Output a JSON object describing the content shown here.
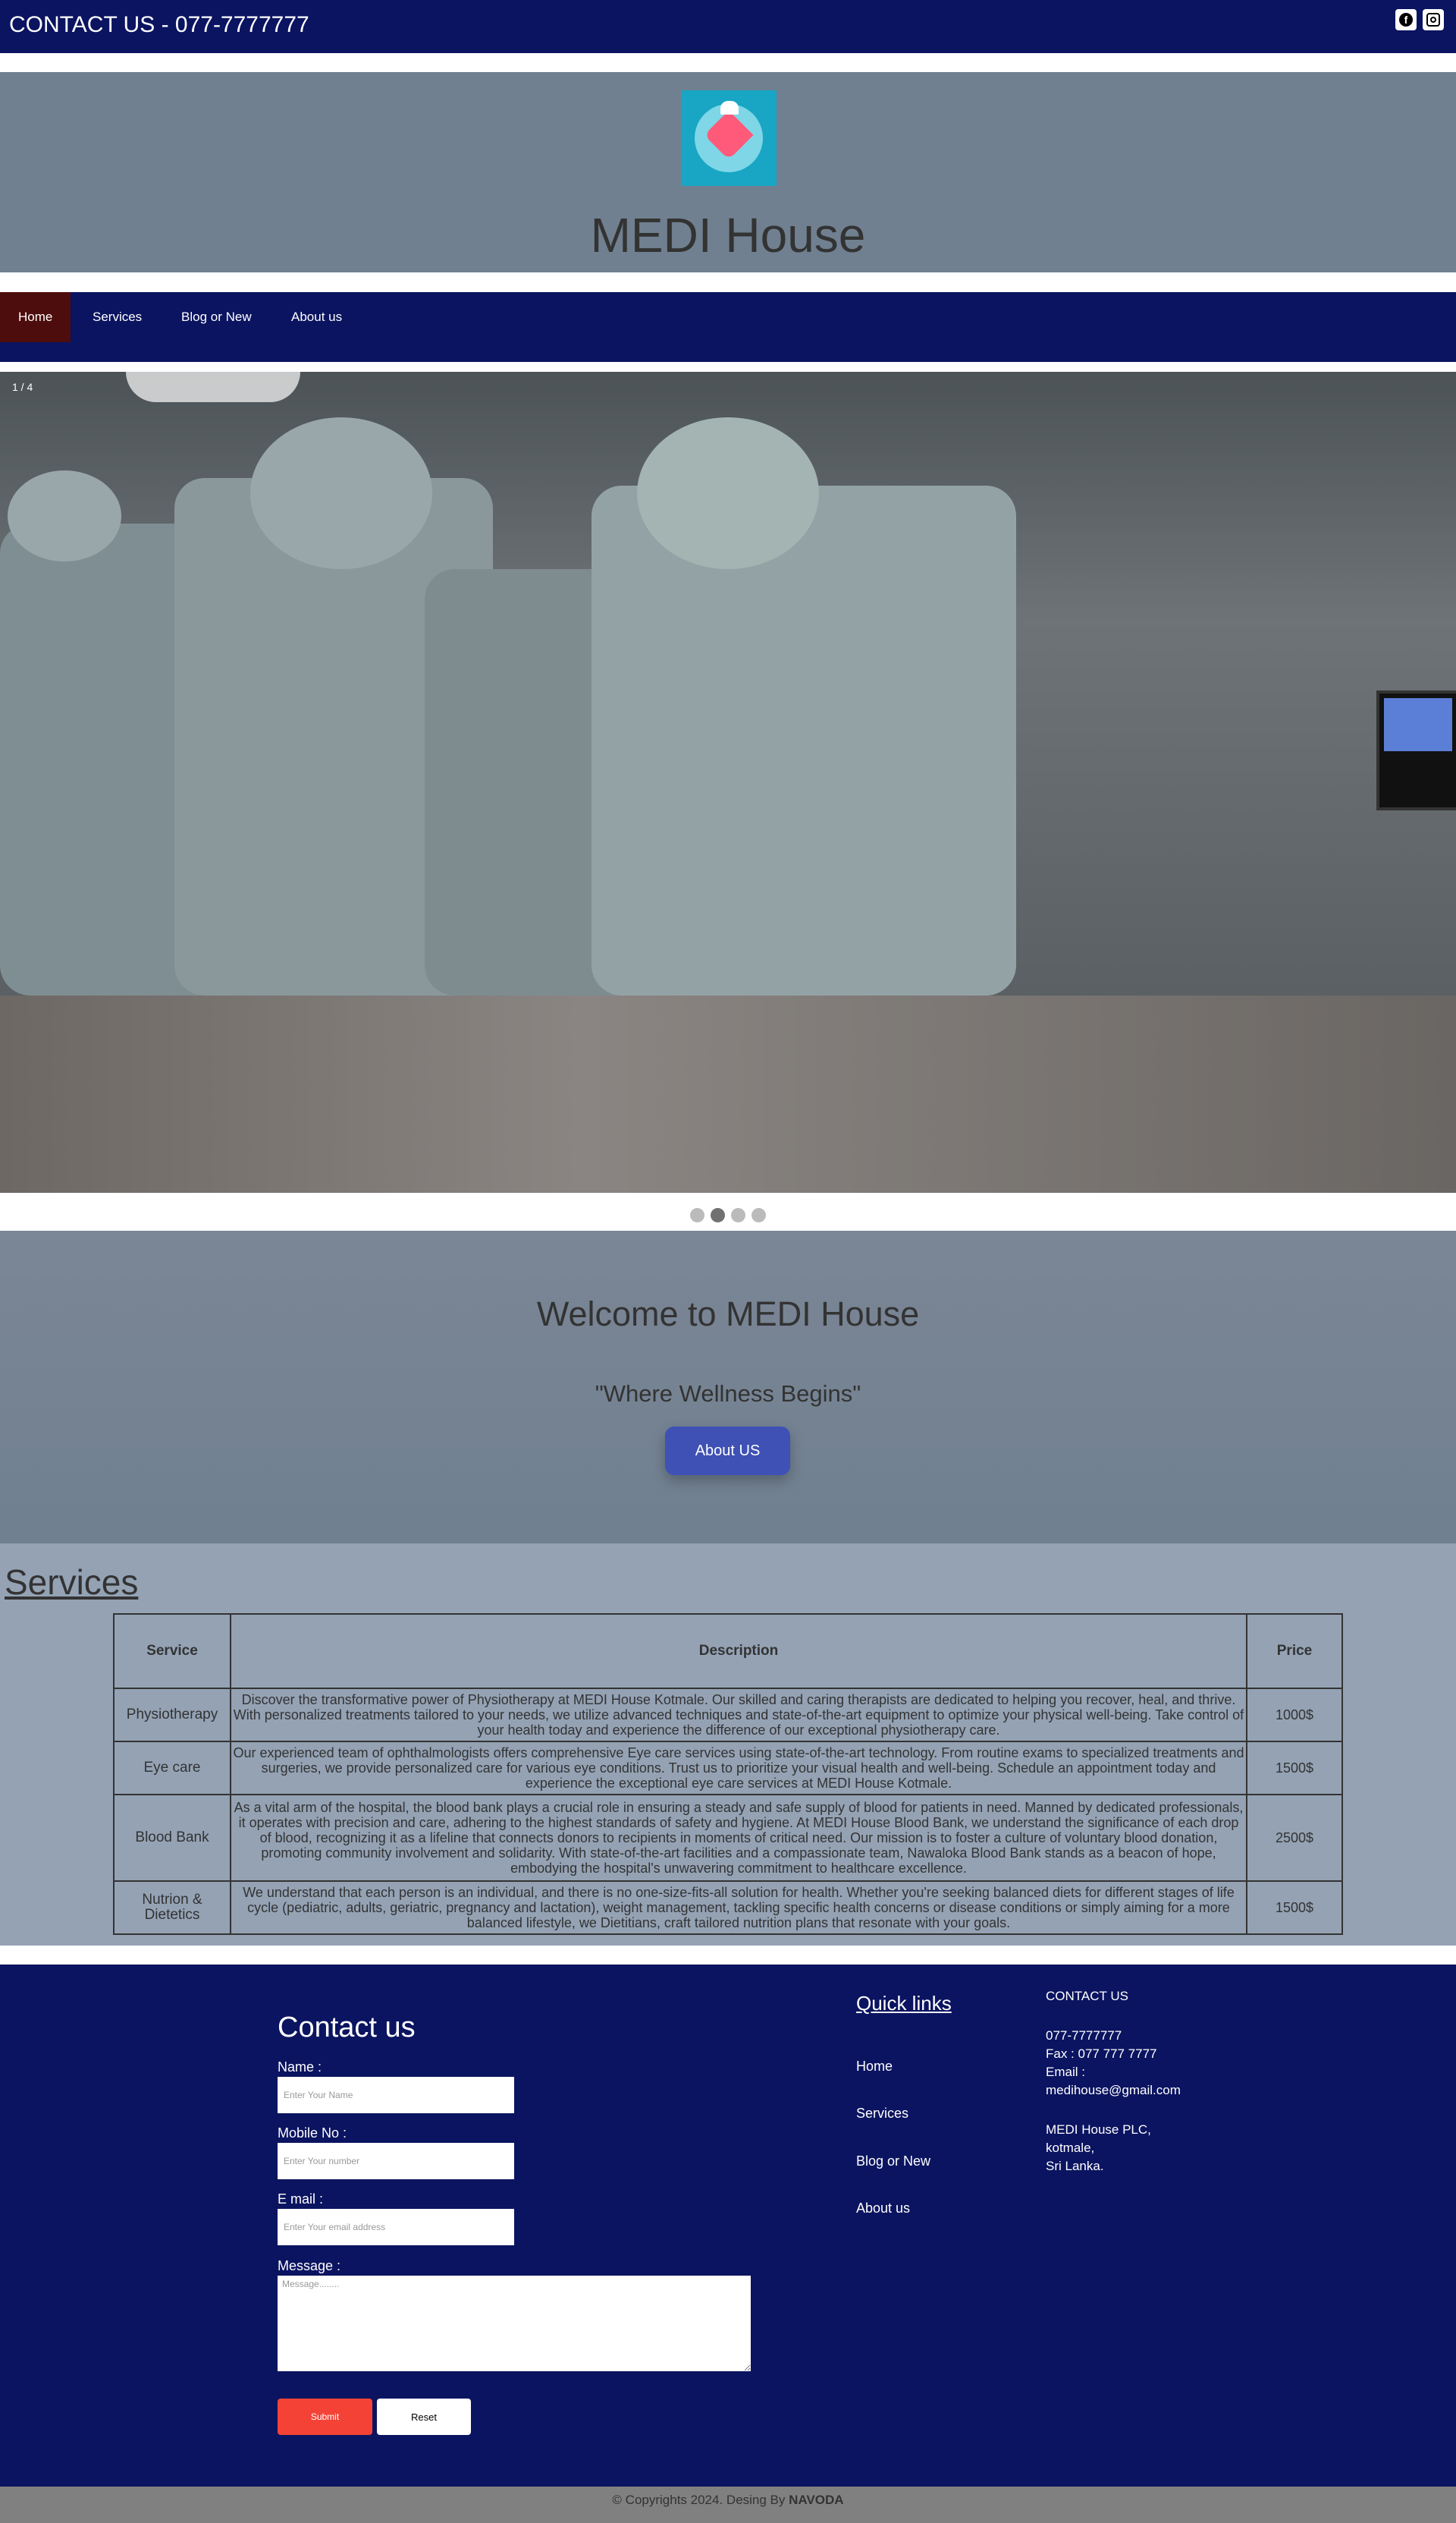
{
  "topbar": {
    "contact": "CONTACT US - 077-7777777",
    "social": [
      "facebook-icon",
      "instagram-icon"
    ]
  },
  "header": {
    "title": "MEDI House"
  },
  "nav": {
    "items": [
      "Home",
      "Services",
      "Blog or New",
      "About us"
    ],
    "active": "Home"
  },
  "slideshow": {
    "counter": "1 / 4",
    "slide_count": 4,
    "active_dot": 2
  },
  "welcome": {
    "heading": "Welcome to MEDI House",
    "tagline": "\"Where Wellness Begins\"",
    "button": "About US"
  },
  "services": {
    "title": "Services",
    "columns": [
      "Service",
      "Description",
      "Price"
    ],
    "rows": [
      {
        "service": "Physiotherapy",
        "description": "Discover the transformative power of Physiotherapy at MEDI House Kotmale. Our skilled and caring therapists are dedicated to helping you recover, heal, and thrive. With personalized treatments tailored to your needs, we utilize advanced techniques and state-of-the-art equipment to optimize your physical well-being. Take control of your health today and experience the difference of our exceptional physiotherapy care.",
        "price": "1000$"
      },
      {
        "service": "Eye care",
        "description": "Our experienced team of ophthalmologists offers comprehensive Eye care services using state-of-the-art technology. From routine exams to specialized treatments and surgeries, we provide personalized care for various eye conditions. Trust us to prioritize your visual health and well-being. Schedule an appointment today and experience the exceptional eye care services at MEDI House Kotmale.",
        "price": "1500$"
      },
      {
        "service": "Blood Bank",
        "description": "As a vital arm of the hospital, the blood bank plays a crucial role in ensuring a steady and safe supply of blood for patients in need. Manned by dedicated professionals, it operates with precision and care, adhering to the highest standards of safety and hygiene. At MEDI House Blood Bank, we understand the significance of each drop of blood, recognizing it as a lifeline that connects donors to recipients in moments of critical need. Our mission is to foster a culture of voluntary blood donation, promoting community involvement and solidarity. With state-of-the-art facilities and a compassionate team, Nawaloka Blood Bank stands as a beacon of hope, embodying the hospital's unwavering commitment to healthcare excellence.",
        "price": "2500$"
      },
      {
        "service": "Nutrion & Dietetics",
        "description": "We understand that each person is an individual, and there is no one-size-fits-all solution for health. Whether you're seeking balanced diets for different stages of life cycle (pediatric, adults, geriatric, pregnancy and lactation), weight management, tackling specific health concerns or disease conditions or simply aiming for a more balanced lifestyle, we Dietitians, craft tailored nutrition plans that resonate with your goals.",
        "price": "1500$"
      }
    ]
  },
  "contact_form": {
    "title": "Contact us",
    "name_label": "Name :",
    "name_placeholder": "Enter Your Name",
    "mobile_label": "Mobile No :",
    "mobile_placeholder": "Enter Your number",
    "email_label": "E mail :",
    "email_placeholder": "Enter Your email address",
    "message_label": "Message :",
    "message_placeholder": "Message........",
    "submit": "Submit",
    "reset": "Reset"
  },
  "quick_links": {
    "title": "Quick links",
    "items": [
      "Home",
      "Services",
      "Blog or New",
      "About us"
    ]
  },
  "contact_info": {
    "title": "CONTACT US",
    "phone": "077-7777777",
    "fax": "Fax : 077 777 7777",
    "email_label": "Email :",
    "email": "medihouse@gmail.com",
    "address": [
      "MEDI House PLC,",
      "kotmale,",
      "Sri Lanka."
    ]
  },
  "footer": {
    "copyright": "© Copyrights 2024. Desing By",
    "author": "NAVODA"
  },
  "colors": {
    "navy": "#0b1460",
    "slate": "#708090",
    "services_bg": "#94a2b4",
    "active_nav": "#4d0d0d",
    "about_btn": "#3f51b5",
    "submit": "#f44336"
  }
}
